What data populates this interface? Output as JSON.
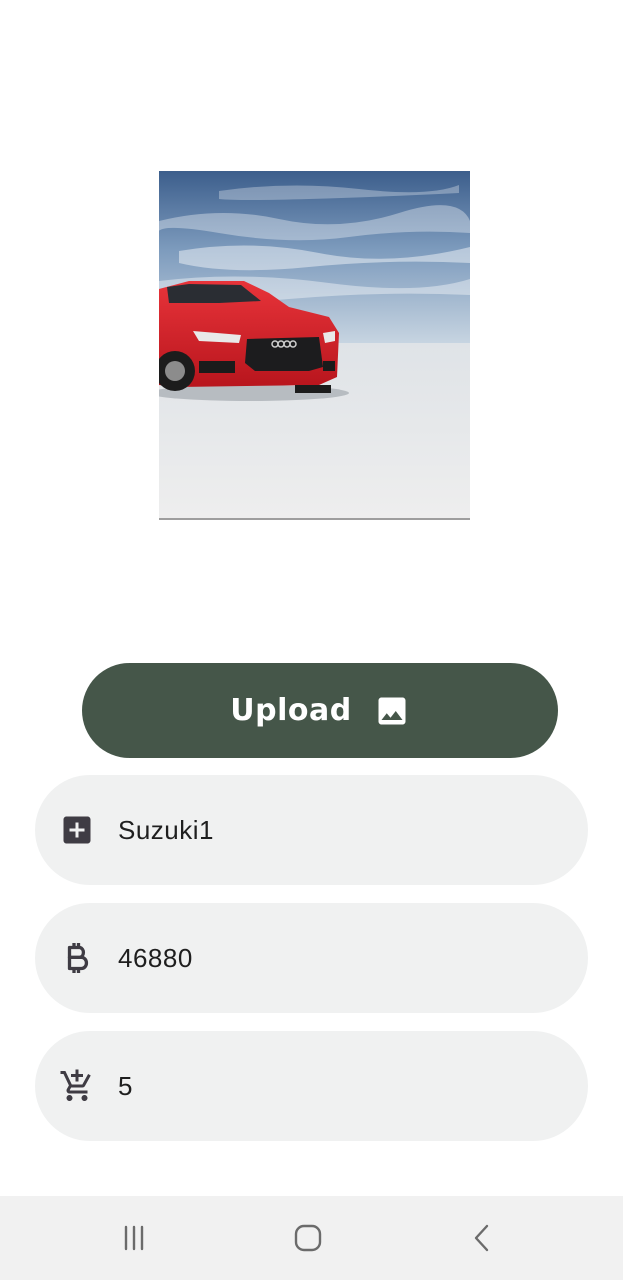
{
  "upload_button": {
    "label": "Upload",
    "icon": "image-icon"
  },
  "fields": {
    "name": {
      "value": "Suzuki1",
      "icon": "add-box-icon"
    },
    "price": {
      "value": "46880",
      "icon": "bitcoin-icon"
    },
    "quantity": {
      "value": "5",
      "icon": "add-shopping-cart-icon"
    }
  },
  "navbar": {
    "items": [
      "recent-apps-icon",
      "home-icon",
      "back-icon"
    ]
  },
  "colors": {
    "button_bg": "#455649",
    "field_bg": "#f0f1f1",
    "icon": "#3f3c44",
    "navbar_bg": "#f1f1f1"
  }
}
